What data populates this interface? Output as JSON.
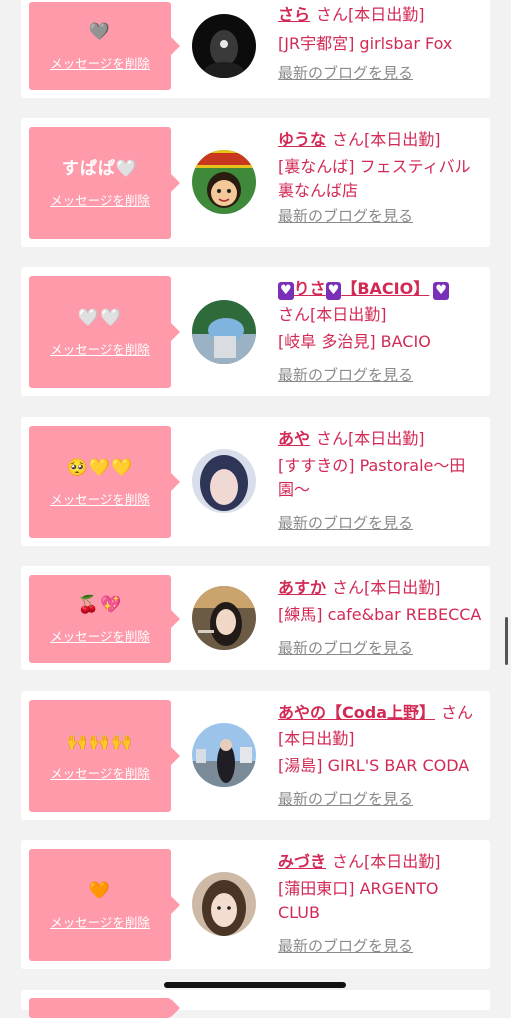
{
  "delete_label": "メッセージを削除",
  "blog_label": "最新のブログを見る",
  "cards": [
    {
      "emoji": "🩶",
      "name": "さら",
      "suffix": "さん[本日出勤]",
      "shop": "[JR宇都宮] girlsbar Fox"
    },
    {
      "emoji": "すぱぱ🤍",
      "name": "ゆうな",
      "suffix": "さん[本日出勤]",
      "shop": "[裏なんば] フェスティバル裏なんば店"
    },
    {
      "emoji": "🤍🤍",
      "name_pre": "💟",
      "name": "りさ",
      "name_mid": "💟",
      "name_post": "【BACIO】",
      "name_end": "💟",
      "suffix": "さん[本日出勤]",
      "shop": "[岐阜 多治見] BACIO"
    },
    {
      "emoji": "🥺💛💛",
      "name": "あや",
      "suffix": "さん[本日出勤]",
      "shop": "[すすきの] Pastorale〜田園〜"
    },
    {
      "emoji": "🍒💖",
      "name": "あすか",
      "suffix": "さん[本日出勤]",
      "shop": "[練馬] cafe&bar REBECCA"
    },
    {
      "emoji": "🙌🙌🙌",
      "name": "あやの【Coda上野】",
      "suffix": "さん[本日出勤]",
      "shop": "[湯島] GIRL'S BAR CODA"
    },
    {
      "emoji": "🧡",
      "name": "みづき",
      "suffix": "さん[本日出勤]",
      "shop": "[蒲田東口] ARGENTO CLUB"
    }
  ],
  "colors": {
    "background": "#f2f2f2",
    "bubble": "#ff9aab",
    "accent_text": "#d22a55",
    "muted_text": "#8a8a8a"
  }
}
